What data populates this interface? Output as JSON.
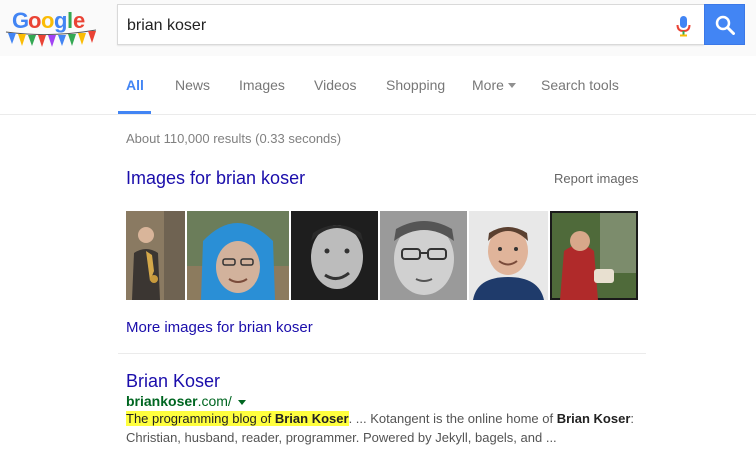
{
  "header": {
    "logo_alt": "Google",
    "query": "brian koser",
    "mic_icon": "microphone-icon",
    "search_icon": "search-icon",
    "brand_blue": "#4285f4"
  },
  "tabs": [
    {
      "label": "All",
      "active": true
    },
    {
      "label": "News"
    },
    {
      "label": "Images"
    },
    {
      "label": "Videos"
    },
    {
      "label": "Shopping"
    },
    {
      "label": "More"
    },
    {
      "label": "Search tools"
    }
  ],
  "stats": "About 110,000 results (0.33 seconds)",
  "images": {
    "title": "Images for brian koser",
    "report": "Report images",
    "more": "More images for brian koser"
  },
  "result": {
    "title": "Brian Koser",
    "url_bold": "briankoser",
    "url_rest": ".com/",
    "snippet_hl_pre": "The programming blog of ",
    "snippet_hl_bold": "Brian Koser",
    "snippet_mid1": ". ... Kotangent is the online home of ",
    "snippet_bold2": "Brian Koser",
    "snippet_line2": ": Christian, husband, reader, programmer. Powered by Jekyll, bagels, and ..."
  }
}
